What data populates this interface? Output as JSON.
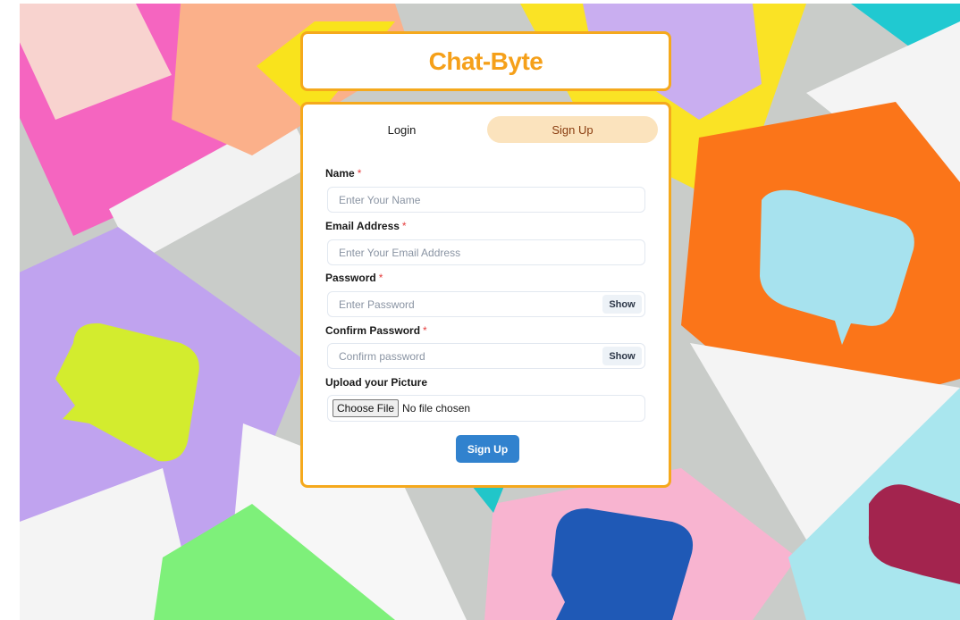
{
  "app": {
    "title": "Chat-Byte"
  },
  "tabs": [
    {
      "label": "Login",
      "active": false
    },
    {
      "label": "Sign Up",
      "active": true
    }
  ],
  "form": {
    "required_mark": "*",
    "name": {
      "label": "Name",
      "placeholder": "Enter Your Name",
      "value": ""
    },
    "email": {
      "label": "Email Address",
      "placeholder": "Enter Your Email Address",
      "value": ""
    },
    "password": {
      "label": "Password",
      "placeholder": "Enter Password",
      "toggle_label": "Show"
    },
    "confirm_password": {
      "label": "Confirm Password",
      "placeholder": "Confirm password",
      "toggle_label": "Show"
    },
    "picture": {
      "label": "Upload your Picture",
      "button_label": "Choose File",
      "status": "No file chosen"
    },
    "submit_label": "Sign Up"
  },
  "colors": {
    "brand": "#f5a01a",
    "active_tab_bg": "#fbe3bd",
    "active_tab_text": "#8a3d10",
    "primary_button": "#3182ce",
    "required": "#e53e3e"
  }
}
